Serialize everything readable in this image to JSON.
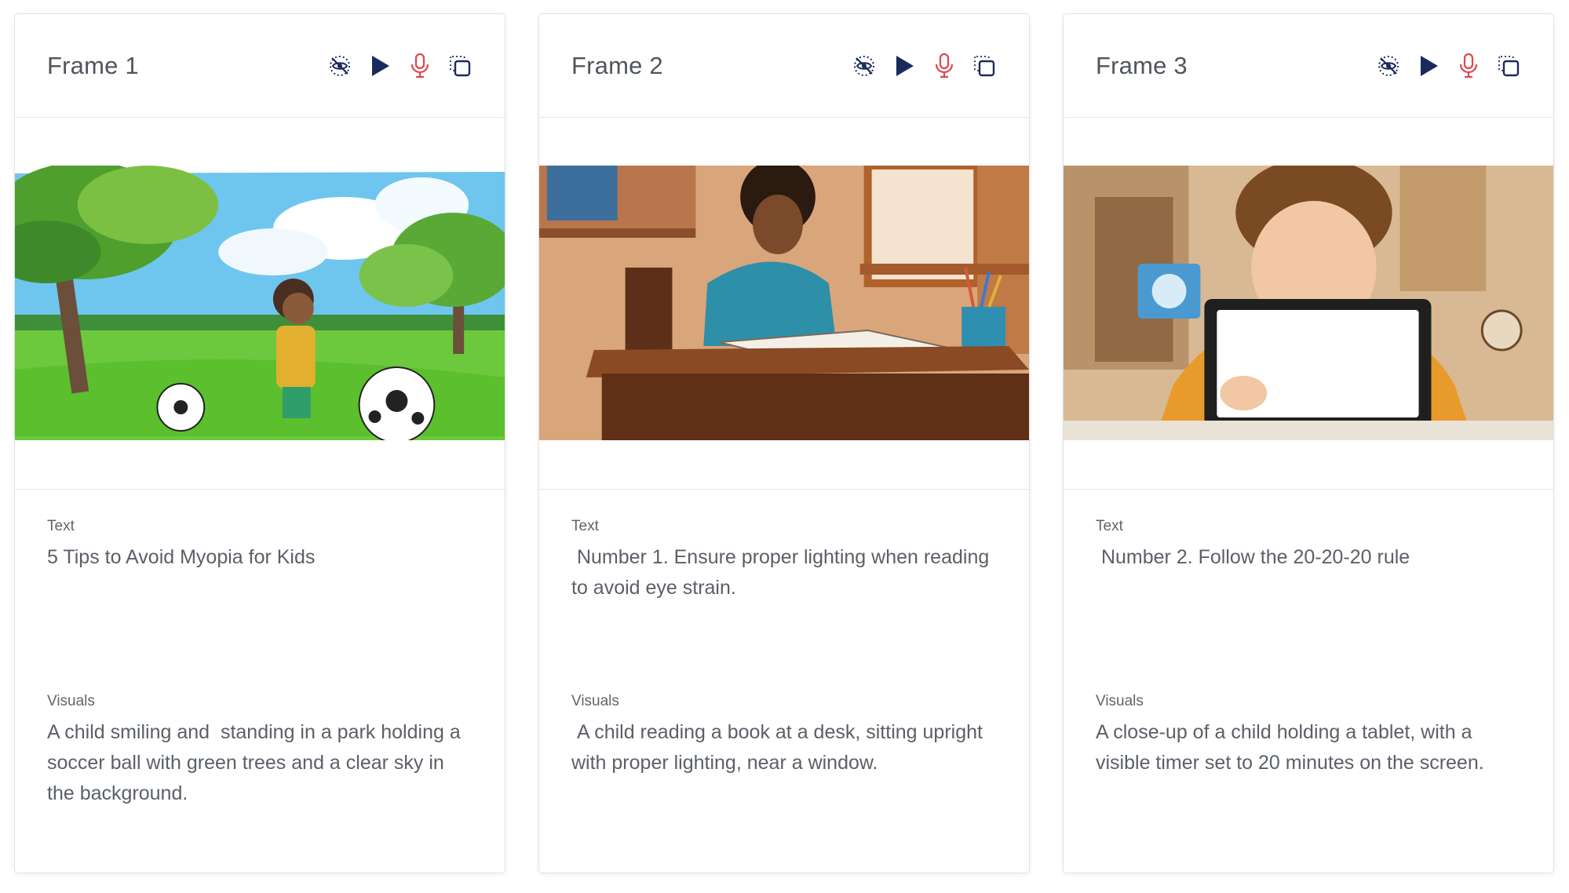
{
  "frames": [
    {
      "title": "Frame 1",
      "text_label": "Text",
      "text": "5 Tips to Avoid Myopia for Kids",
      "visuals_label": "Visuals",
      "visuals": "A child smiling and  standing in a park holding a soccer ball with green trees and a clear sky in the background."
    },
    {
      "title": "Frame 2",
      "text_label": "Text",
      "text": " Number 1. Ensure proper lighting when reading to avoid eye strain.",
      "visuals_label": "Visuals",
      "visuals": " A child reading a book at a desk, sitting upright with proper lighting, near a window."
    },
    {
      "title": "Frame 3",
      "text_label": "Text",
      "text": " Number 2. Follow the 20-20-20 rule",
      "visuals_label": "Visuals",
      "visuals": "A close-up of a child holding a tablet, with a visible timer set to 20 minutes on the screen."
    }
  ],
  "toolbar_icons": [
    "eye-off-icon",
    "play-icon",
    "microphone-icon",
    "copy-frame-icon"
  ],
  "colors": {
    "icon_navy": "#1b2a5c",
    "icon_red": "#e0474c",
    "border": "#dfe2e7"
  }
}
